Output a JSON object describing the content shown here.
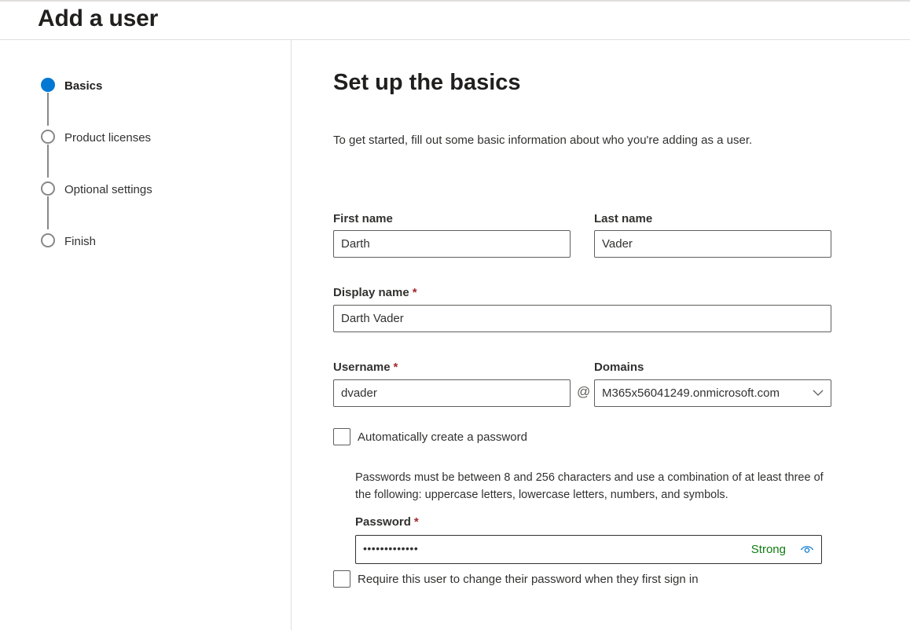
{
  "page": {
    "title": "Add a user"
  },
  "stepper": {
    "steps": [
      {
        "label": "Basics",
        "state": "active"
      },
      {
        "label": "Product licenses",
        "state": "inactive"
      },
      {
        "label": "Optional settings",
        "state": "inactive"
      },
      {
        "label": "Finish",
        "state": "inactive"
      }
    ]
  },
  "main": {
    "title": "Set up the basics",
    "intro": "To get started, fill out some basic information about who you're adding as a user."
  },
  "form": {
    "first_name": {
      "label": "First name",
      "value": "Darth"
    },
    "last_name": {
      "label": "Last name",
      "value": "Vader"
    },
    "display_name": {
      "label": "Display name",
      "required": "*",
      "value": "Darth Vader"
    },
    "username": {
      "label": "Username",
      "required": "*",
      "value": "dvader"
    },
    "at_symbol": "@",
    "domains": {
      "label": "Domains",
      "value": "M365x56041249.onmicrosoft.com"
    },
    "auto_password": {
      "label": "Automatically create a password",
      "checked": false
    },
    "password_help": "Passwords must be between 8 and 256 characters and use a combination of at least three of the following: uppercase letters, lowercase letters, numbers, and symbols.",
    "password": {
      "label": "Password",
      "required": "*",
      "masked": "•••••••••••••",
      "strength": "Strong"
    },
    "require_change": {
      "label": "Require this user to change their password when they first sign in",
      "checked": false
    }
  },
  "colors": {
    "accent": "#0078d4",
    "strength_strong": "#107c10",
    "required": "#a4262c",
    "eye_icon": "#0078d4"
  }
}
